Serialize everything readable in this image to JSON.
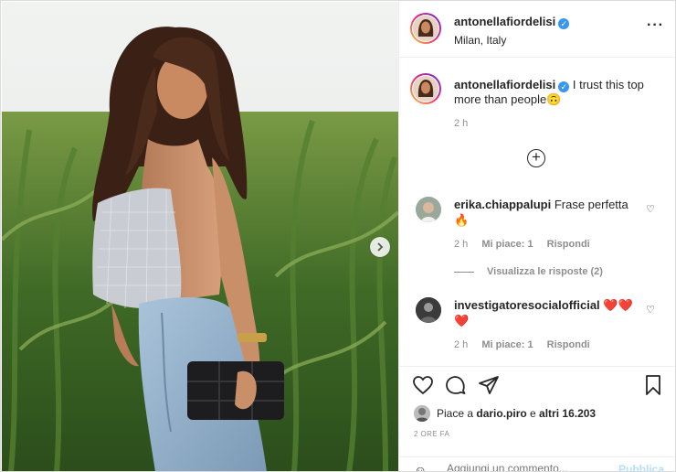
{
  "post": {
    "username": "antonellafiordelisi",
    "location": "Milan, Italy",
    "verified_icon": "verified-badge-icon",
    "more_icon": "more-options-icon"
  },
  "caption": {
    "username": "antonellafiordelisi",
    "text": "I trust this top more than people🙃",
    "age": "2 h"
  },
  "load_more_icon": "plus-circle-icon",
  "comments": [
    {
      "username": "erika.chiappalupi",
      "text": "Frase perfetta 🔥",
      "age": "2 h",
      "likes": "Mi piace: 1",
      "reply": "Rispondi",
      "view_replies": "Visualizza le risposte (2)"
    },
    {
      "username": "investigatoresocialofficial",
      "text": "❤️❤️❤️",
      "age": "2 h",
      "likes": "Mi piace: 1",
      "reply": "Rispondi"
    }
  ],
  "likes": {
    "prefix": "Piace a ",
    "user": "dario.piro",
    "middle": " e ",
    "count": "altri 16.203"
  },
  "timestamp": "2 ORE FA",
  "add_comment": {
    "placeholder": "Aggiungi un commento...",
    "publish": "Pubblica"
  },
  "colors": {
    "accent": "#3897f0",
    "heart": "#ed4956"
  }
}
